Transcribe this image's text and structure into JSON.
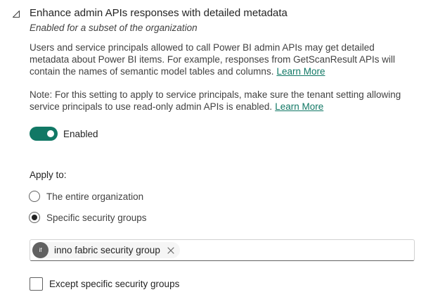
{
  "setting": {
    "title": "Enhance admin APIs responses with detailed metadata",
    "subtitle": "Enabled for a subset of the organization",
    "description_lines": [
      "Users and service principals allowed to call Power BI admin APIs may get detailed",
      "metadata about Power BI items. For example, responses from GetScanResult APIs will",
      "contain the names of semantic model tables and columns."
    ],
    "description_link": "Learn More",
    "note_lines": [
      "Note: For this setting to apply to service principals, make sure the tenant setting allowing",
      "service principals to use read-only admin APIs is enabled."
    ],
    "note_link": "Learn More",
    "toggle": {
      "label": "Enabled",
      "on": true
    },
    "apply_to": {
      "label": "Apply to:",
      "options": [
        {
          "label": "The entire organization",
          "selected": false
        },
        {
          "label": "Specific security groups",
          "selected": true
        }
      ]
    },
    "groups": [
      {
        "initials": "if",
        "name": "inno fabric security group"
      }
    ],
    "except": {
      "label": "Except specific security groups",
      "checked": false
    }
  },
  "icons": {
    "collapse": "collapse-triangle-icon",
    "remove": "dismiss-icon"
  },
  "colors": {
    "accent": "#117865",
    "text": "#242424",
    "secondary_text": "#424242"
  }
}
